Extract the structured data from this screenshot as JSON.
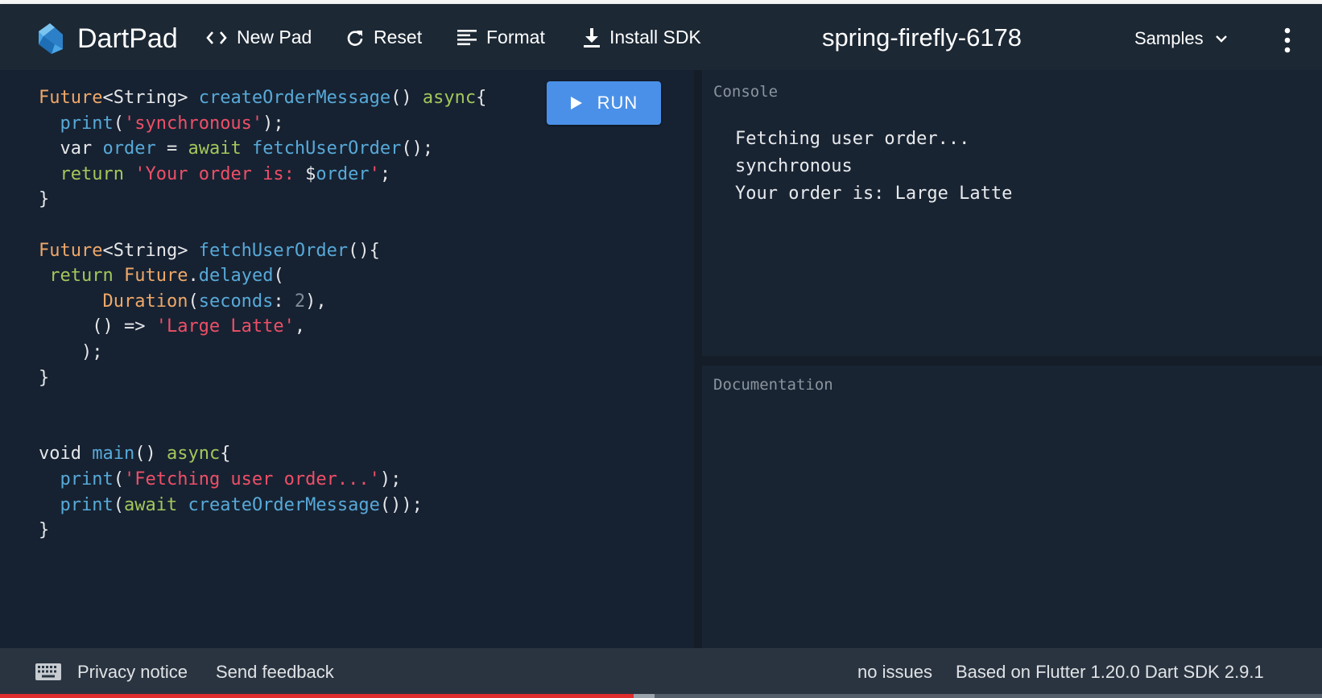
{
  "header": {
    "brand": "DartPad",
    "new_pad": "New Pad",
    "reset": "Reset",
    "format": "Format",
    "install_sdk": "Install SDK",
    "pad_title": "spring-firefly-6178",
    "samples": "Samples"
  },
  "editor": {
    "run_label": "RUN",
    "code_lines": [
      "Future<String> createOrderMessage() async{",
      "  print('synchronous');",
      "  var order = await fetchUserOrder();",
      "  return 'Your order is: $order';",
      "}",
      "",
      "Future<String> fetchUserOrder(){",
      " return Future.delayed(",
      "      Duration(seconds: 2),",
      "     () => 'Large Latte',",
      "    );",
      "}",
      "",
      "",
      "void main() async{",
      "  print('Fetching user order...');",
      "  print(await createOrderMessage());",
      "}"
    ]
  },
  "console": {
    "label": "Console",
    "lines": [
      "Fetching user order...",
      "synchronous",
      "Your order is: Large Latte"
    ]
  },
  "documentation": {
    "label": "Documentation"
  },
  "footer": {
    "privacy": "Privacy notice",
    "feedback": "Send feedback",
    "issues": "no issues",
    "version": "Based on Flutter 1.20.0 Dart SDK 2.9.1"
  },
  "video_progress": {
    "played_fraction": 0.479,
    "buffered_fraction": 0.495
  },
  "icons": [
    "dart-logo-icon",
    "code-brackets-icon",
    "refresh-icon",
    "format-lines-icon",
    "download-icon",
    "chevron-down-icon",
    "more-vert-icon",
    "play-icon",
    "keyboard-icon"
  ],
  "colors": {
    "run_button": "#4a90e8",
    "string": "#ef4f67",
    "type": "#f0a868",
    "keyword": "#a4c75b",
    "function": "#58a9d8"
  }
}
